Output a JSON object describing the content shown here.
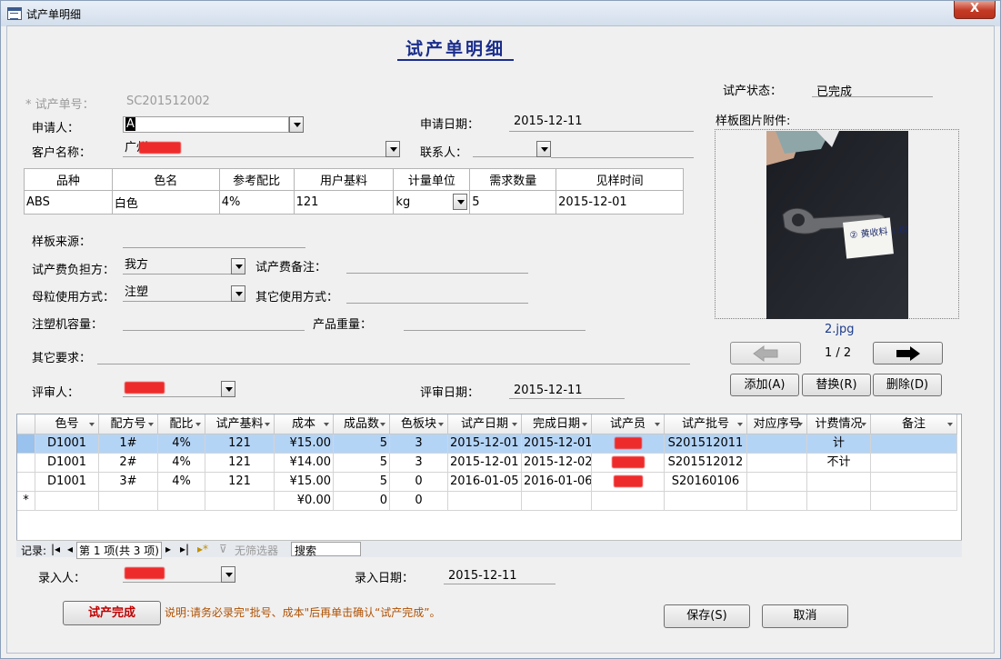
{
  "window": {
    "title": "试产单明细",
    "close": "X"
  },
  "form": {
    "title": "试产单明细",
    "trial_no_label": "* 试产单号：",
    "trial_no": "SC201512002",
    "status_label": "试产状态：",
    "status": "已完成",
    "applicant_label": "申请人：",
    "applicant": "A",
    "apply_date_label": "申请日期：",
    "apply_date": "2015-12-11",
    "customer_label": "客户名称：",
    "customer": "广州",
    "contact_label": "联系人：",
    "contact": "",
    "attachment_label": "样板图片附件:",
    "sample_source_label": "样板来源：",
    "fee_bearer_label": "试产费负担方：",
    "fee_bearer": "我方",
    "fee_note_label": "试产费备注：",
    "masterbatch_label": "母粒使用方式：",
    "masterbatch": "注塑",
    "other_use_label": "其它使用方式：",
    "machine_cap_label": "注塑机容量：",
    "product_weight_label": "产品重量：",
    "other_req_label": "其它要求：",
    "reviewer_label": "评审人：",
    "review_date_label": "评审日期：",
    "review_date": "2015-12-11",
    "entry_label": "录入人：",
    "entry_date_label": "录入日期：",
    "entry_date": "2015-12-11",
    "note": "说明:请务必录完\"批号、成本\"后再单击确认“试产完成”。"
  },
  "spec_table": {
    "headers": [
      "品种",
      "色名",
      "参考配比",
      "用户基料",
      "计量单位",
      "需求数量",
      "见样时间"
    ],
    "row": [
      "ABS",
      "白色",
      "4%",
      "121",
      "kg",
      "5",
      "2015-12-01"
    ]
  },
  "attachment": {
    "filename": "2.jpg",
    "counter": "1 / 2",
    "add": "添加(A)",
    "replace": "替换(R)",
    "delete": "删除(D)",
    "note_text": "② 黄收料 1.8/4"
  },
  "grid": {
    "headers": [
      "色号",
      "配方号",
      "配比",
      "试产基料",
      "成本",
      "成品数",
      "色板块",
      "试产日期",
      "完成日期",
      "试产员",
      "试产批号",
      "对应序号",
      "计费情况",
      "备注"
    ],
    "rows": [
      [
        "D1001",
        "1#",
        "4%",
        "121",
        "¥15.00",
        "5",
        "3",
        "2015-12-01",
        "2015-12-01",
        "",
        "S201512011",
        "",
        "计",
        ""
      ],
      [
        "D1001",
        "2#",
        "4%",
        "121",
        "¥14.00",
        "5",
        "3",
        "2015-12-01",
        "2015-12-02",
        "",
        "S201512012",
        "",
        "不计",
        ""
      ],
      [
        "D1001",
        "3#",
        "4%",
        "121",
        "¥15.00",
        "5",
        "0",
        "2016-01-05",
        "2016-01-06",
        "",
        "S20160106",
        "",
        "",
        ""
      ]
    ],
    "new_row": {
      "marker": "*",
      "cost": "¥0.00",
      "qty": "0",
      "plates": "0"
    },
    "nav": {
      "record_label": "记录:",
      "position": "第 1 项(共 3 项)",
      "no_filter": "无筛选器",
      "search": "搜索"
    }
  },
  "buttons": {
    "complete": "试产完成",
    "save": "保存(S)",
    "cancel": "取消"
  },
  "colors": {
    "title": "#1a2e8c",
    "complete_text": "#c00000",
    "note_text": "#b05000",
    "selected_row": "#b4d4f6"
  }
}
